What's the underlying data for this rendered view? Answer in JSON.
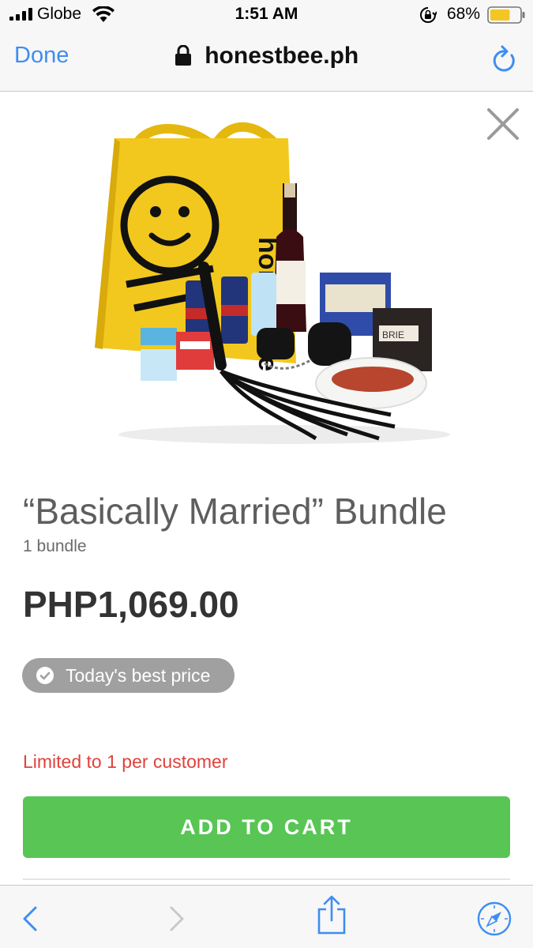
{
  "status_bar": {
    "carrier": "Globe",
    "time": "1:51 AM",
    "battery_percent": "68%",
    "battery_level": 0.68,
    "icons": [
      "signal-icon",
      "wifi-icon",
      "rotation-lock-icon",
      "battery-icon"
    ]
  },
  "url_bar": {
    "done_label": "Done",
    "url": "honestbee.ph",
    "icons": [
      "lock-icon",
      "reload-icon"
    ]
  },
  "product": {
    "title": "“Basically Married” Bundle",
    "quantity": "1 bundle",
    "price": "PHP1,069.00",
    "badge": "Today's best price",
    "limit": "Limited to 1 per customer",
    "cta": "ADD TO CART"
  },
  "toolbar": {
    "icons": [
      "back-icon",
      "forward-icon",
      "share-icon",
      "compass-icon"
    ]
  },
  "colors": {
    "link_blue": "#3d8ef1",
    "cta_green": "#58c555",
    "limit_red": "#e2413a",
    "badge_gray": "#a0a0a0",
    "bag_yellow": "#f2c81e"
  }
}
